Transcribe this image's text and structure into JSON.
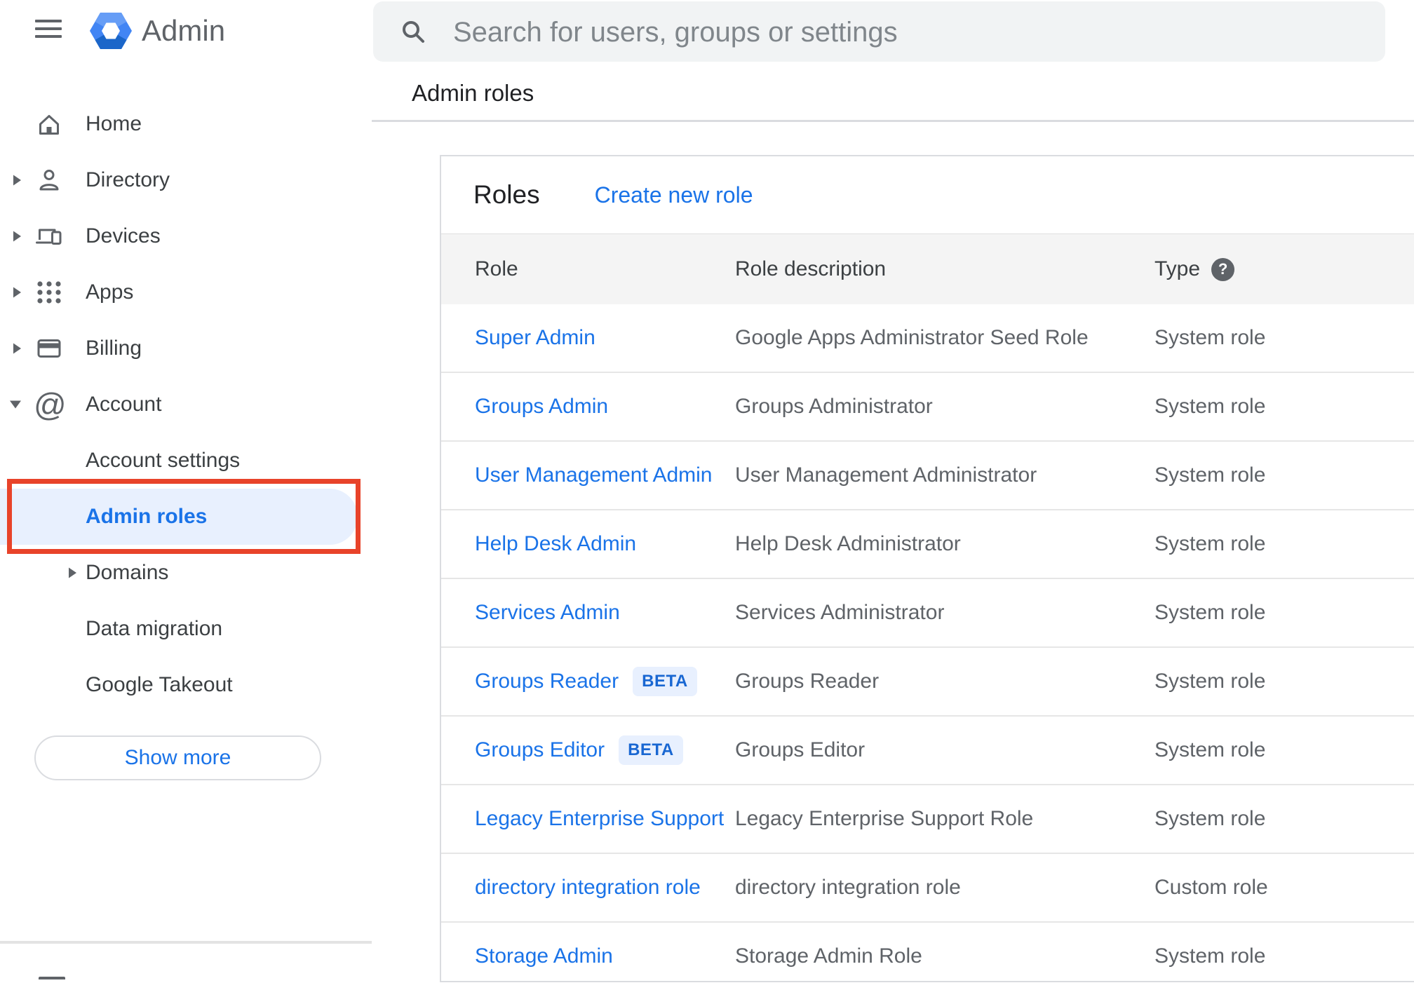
{
  "app": {
    "title": "Admin"
  },
  "search": {
    "placeholder": "Search for users, groups or settings"
  },
  "breadcrumb": "Admin roles",
  "sidebar": {
    "items": [
      {
        "label": "Home"
      },
      {
        "label": "Directory"
      },
      {
        "label": "Devices"
      },
      {
        "label": "Apps"
      },
      {
        "label": "Billing"
      },
      {
        "label": "Account"
      },
      {
        "label": "Account settings"
      },
      {
        "label": "Admin roles"
      },
      {
        "label": "Domains"
      },
      {
        "label": "Data migration"
      },
      {
        "label": "Google Takeout"
      }
    ],
    "show_more_label": "Show more"
  },
  "main": {
    "card_title": "Roles",
    "create_link": "Create new role",
    "table": {
      "columns": [
        "Role",
        "Role description",
        "Type"
      ],
      "help_glyph": "?",
      "rows": [
        {
          "role": "Super Admin",
          "badge": "",
          "description": "Google Apps Administrator Seed Role",
          "type": "System role"
        },
        {
          "role": "Groups Admin",
          "badge": "",
          "description": "Groups Administrator",
          "type": "System role"
        },
        {
          "role": "User Management Admin",
          "badge": "",
          "description": "User Management Administrator",
          "type": "System role"
        },
        {
          "role": "Help Desk Admin",
          "badge": "",
          "description": "Help Desk Administrator",
          "type": "System role"
        },
        {
          "role": "Services Admin",
          "badge": "",
          "description": "Services Administrator",
          "type": "System role"
        },
        {
          "role": "Groups Reader",
          "badge": "BETA",
          "description": "Groups Reader",
          "type": "System role"
        },
        {
          "role": "Groups Editor",
          "badge": "BETA",
          "description": "Groups Editor",
          "type": "System role"
        },
        {
          "role": "Legacy Enterprise Support",
          "badge": "",
          "description": "Legacy Enterprise Support Role",
          "type": "System role"
        },
        {
          "role": "directory integration role",
          "badge": "",
          "description": "directory integration role",
          "type": "Custom role"
        },
        {
          "role": "Storage Admin",
          "badge": "",
          "description": "Storage Admin Role",
          "type": "System role"
        }
      ]
    }
  },
  "colors": {
    "accent": "#1a73e8",
    "annotation_red": "#e8432a",
    "selected_bg": "#e8f0fe",
    "badge_bg": "#e8f0fe",
    "badge_text": "#1967d2",
    "header_band_bg": "#f4f4f4"
  }
}
